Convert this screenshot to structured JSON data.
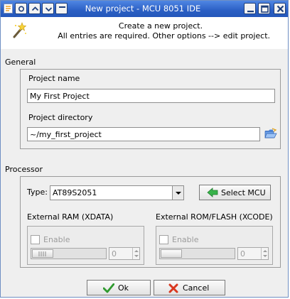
{
  "window": {
    "title": "New project - MCU 8051 IDE"
  },
  "header": {
    "line1": "Create a new project.",
    "line2": "All entries are required. Other options --> edit project."
  },
  "general": {
    "title": "General",
    "project_name_label": "Project name",
    "project_name_value": "My First Project",
    "project_dir_label": "Project directory",
    "project_dir_value": "~/my_first_project"
  },
  "processor": {
    "title": "Processor",
    "type_label": "Type:",
    "type_value": "AT89S2051",
    "select_mcu_label": "Select MCU",
    "xdata": {
      "title": "External RAM (XDATA)",
      "enable_label": "Enable",
      "value": "0"
    },
    "xcode": {
      "title": "External ROM/FLASH (XCODE)",
      "enable_label": "Enable",
      "value": "0"
    }
  },
  "buttons": {
    "ok_label": "Ok",
    "cancel_label": "Cancel"
  },
  "colors": {
    "titlebar": "#2b5fc4",
    "ok_check": "#2e9a2e",
    "cancel_x": "#d9371f"
  }
}
